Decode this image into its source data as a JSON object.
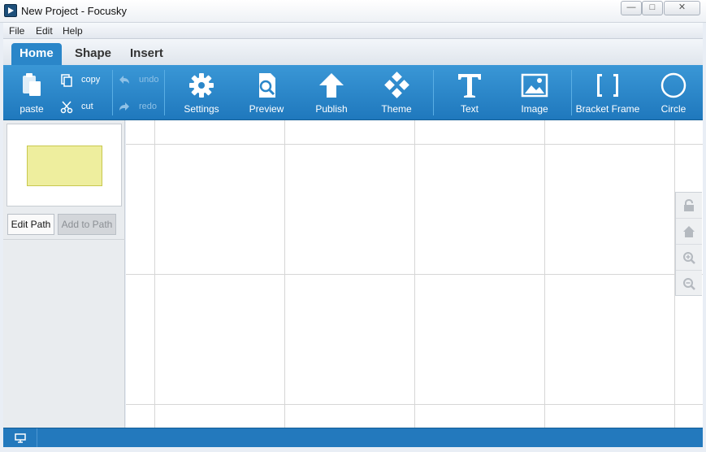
{
  "window": {
    "title": "New Project - Focusky"
  },
  "menu": {
    "items": [
      "File",
      "Edit",
      "Help"
    ]
  },
  "tabs": [
    "Home",
    "Shape",
    "Insert"
  ],
  "ribbon": {
    "paste": "paste",
    "copy": "copy",
    "cut": "cut",
    "undo": "undo",
    "redo": "redo",
    "settings": "Settings",
    "preview": "Preview",
    "publish": "Publish",
    "theme": "Theme",
    "text": "Text",
    "image": "Image",
    "bracket_frame": "Bracket Frame",
    "circle": "Circle"
  },
  "panel": {
    "edit_path": "Edit Path",
    "add_to_path": "Add to Path"
  },
  "colors": {
    "ribbon": "#2a86c9",
    "status": "#2379bd",
    "thumb_rect": "#eeee9e"
  }
}
